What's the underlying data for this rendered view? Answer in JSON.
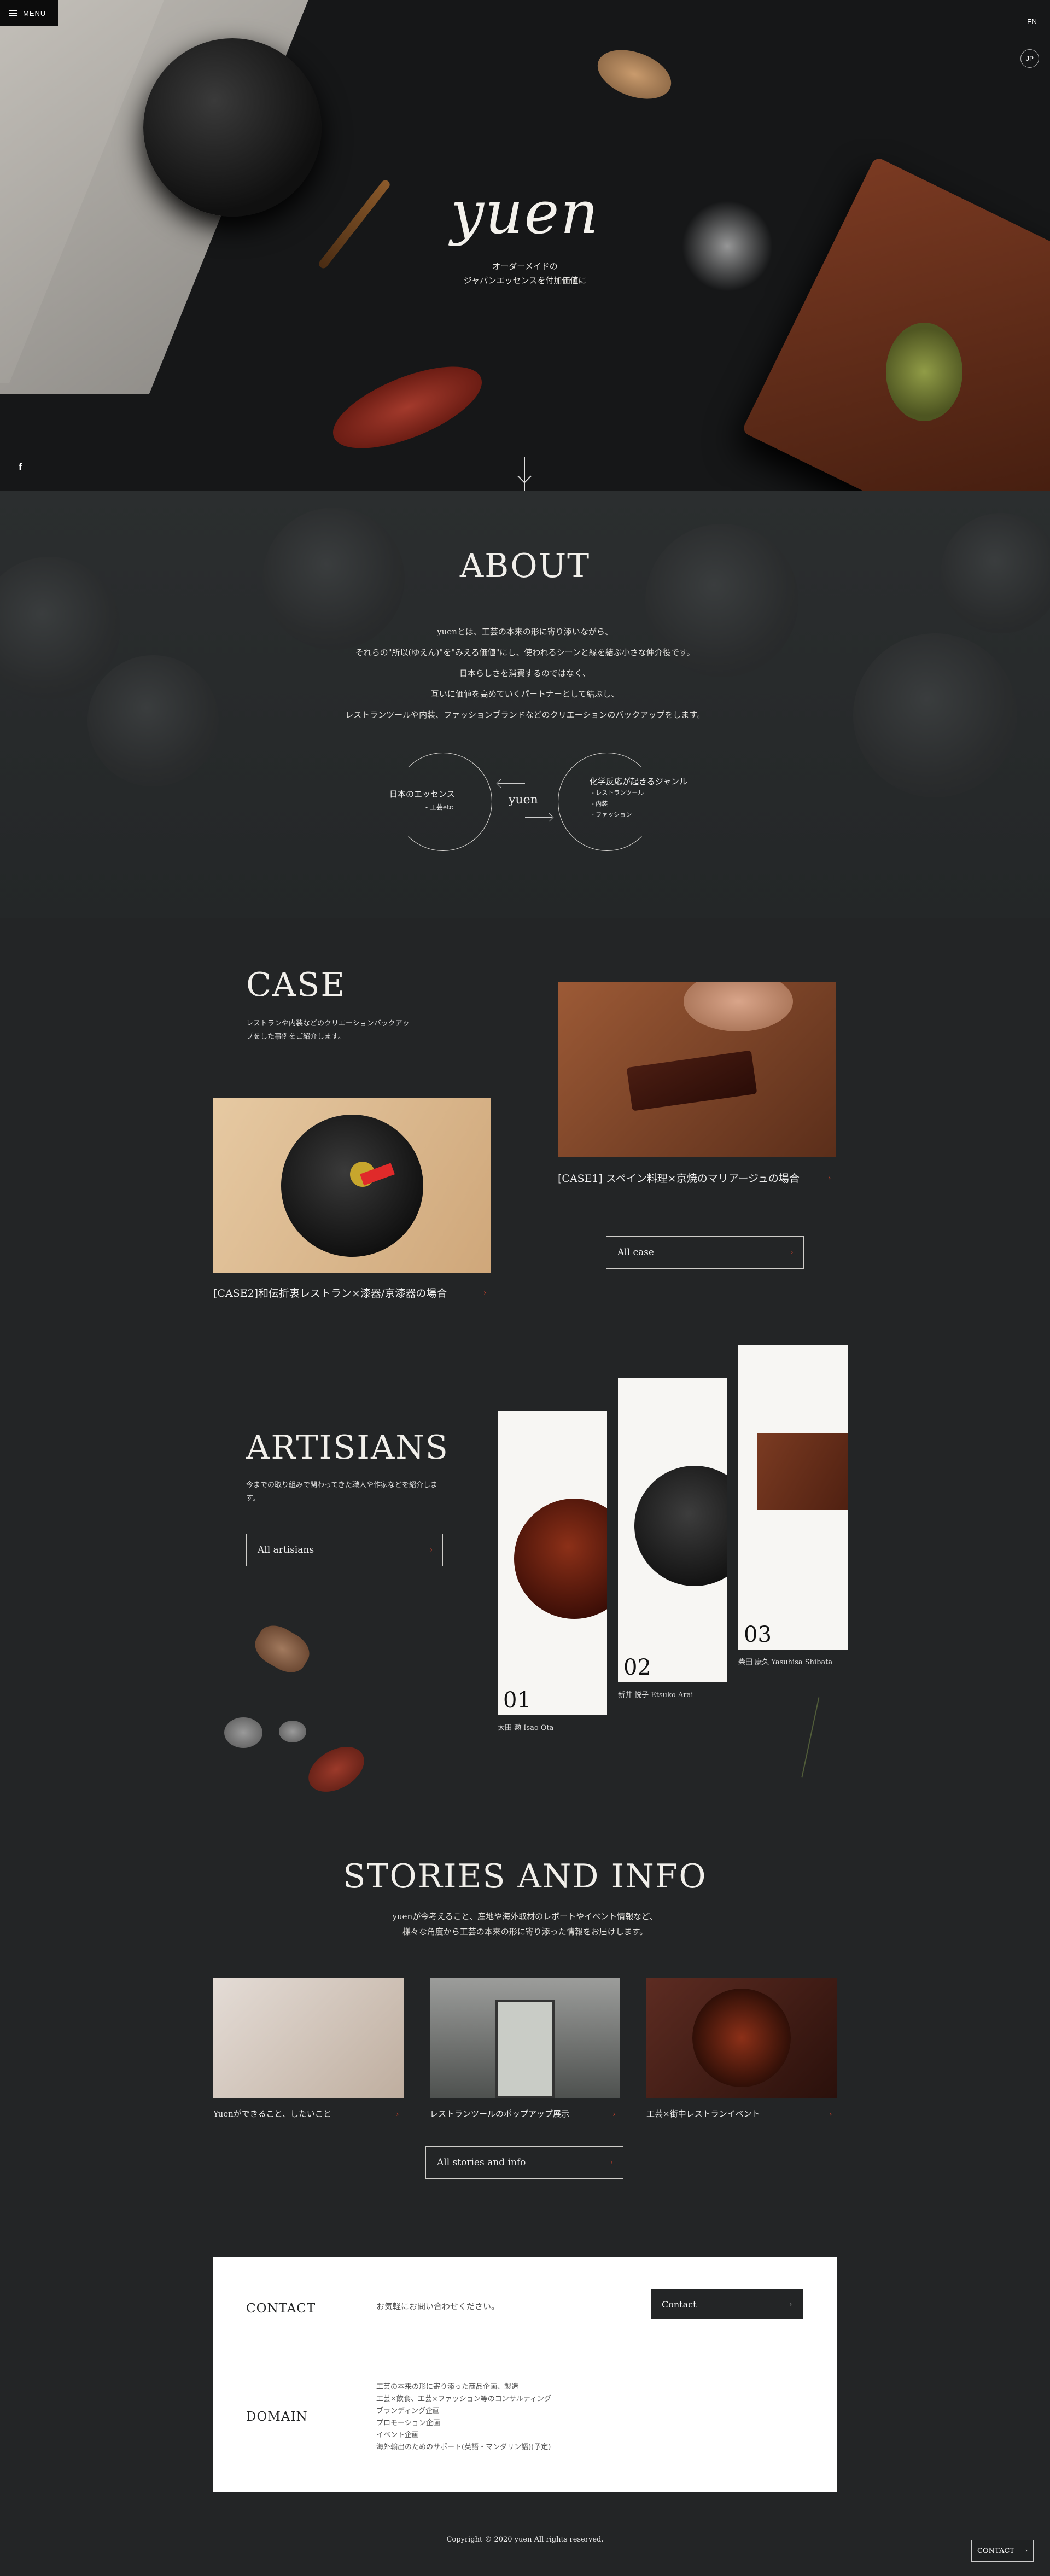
{
  "header": {
    "menu_label": "MENU",
    "lang_en": "EN",
    "lang_jp": "JP"
  },
  "hero": {
    "logo": "yuen",
    "tagline_1": "オーダーメイドの",
    "tagline_2": "ジャパンエッセンスを付加価値に",
    "social_icon": "facebook-icon"
  },
  "about": {
    "title": "ABOUT",
    "lines": [
      "yuenとは、工芸の本来の形に寄り添いながら、",
      "それらの\"所以(ゆえん)\"を\"みえる価値\"にし、使われるシーンと縁を結ぶ小さな仲介役です。",
      "日本らしさを消費するのではなく、",
      "互いに価値を高めていくパートナーとして結ぶし、",
      "レストランツールや内装、ファッションブランドなどのクリエーションのバックアップをします。"
    ],
    "left_heading": "日本のエッセンス",
    "left_sub": "- 工芸etc",
    "center": "yuen",
    "right_heading": "化学反応が起きるジャンル",
    "right_items": [
      "- レストランツール",
      "- 内装",
      "- ファッション"
    ]
  },
  "case": {
    "title": "CASE",
    "desc": "レストランや内装などのクリエーションバックアップをした事例をご紹介します。",
    "items": [
      {
        "caption": "[CASE1] スペイン料理×京焼のマリアージュの場合"
      },
      {
        "caption": "[CASE2]和伝折衷レストラン×漆器/京漆器の場合"
      }
    ],
    "all_button": "All case"
  },
  "artisans": {
    "title": "ARTISIANS",
    "desc": "今までの取り組みで関わってきた職人や作家などを紹介します。",
    "all_button": "All artisians",
    "cards": [
      {
        "num": "01",
        "name": "太田 勲 Isao Ota"
      },
      {
        "num": "02",
        "name": "新井 悦子 Etsuko Arai"
      },
      {
        "num": "03",
        "name": "柴田 康久 Yasuhisa Shibata"
      }
    ]
  },
  "stories": {
    "title": "STORIES AND INFO",
    "desc_1": "yuenが今考えること、産地や海外取材のレポートやイベント情報など、",
    "desc_2": "様々な角度から工芸の本来の形に寄り添った情報をお届けします。",
    "items": [
      {
        "caption": "Yuenができること、したいこと"
      },
      {
        "caption": "レストランツールのポップアップ展示"
      },
      {
        "caption": "工芸×街中レストランイベント"
      }
    ],
    "all_button": "All stories and info"
  },
  "contact": {
    "label": "CONTACT",
    "note": "お気軽にお問い合わせください。",
    "button": "Contact",
    "domain_label": "DOMAIN",
    "domain_items": [
      "工芸の本来の形に寄り添った商品企画、製造",
      "工芸×飲食、工芸×ファッション等のコンサルティング",
      "ブランディング企画",
      "プロモーション企画",
      "イベント企画",
      "海外輸出のためのサポート(英語・マンダリン語)(予定)"
    ]
  },
  "footer": {
    "copyright": "Copyright © 2020 yuen All rights reserved.",
    "float_contact": "CONTACT"
  },
  "colors": {
    "background": "#232526",
    "accent_red": "#c8402a",
    "panel": "#ffffff"
  }
}
